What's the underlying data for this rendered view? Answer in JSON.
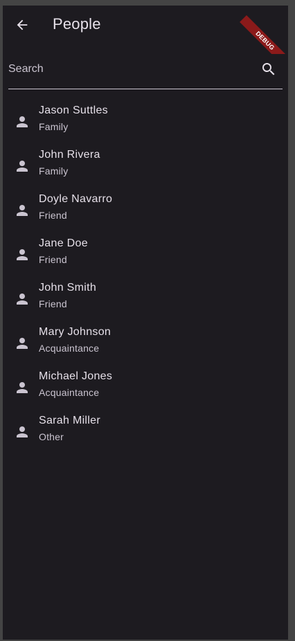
{
  "appbar": {
    "title": "People",
    "back_icon": "arrow-back-icon",
    "debug_label": "DEBUG"
  },
  "search": {
    "placeholder": "Search",
    "value": "",
    "icon": "search-icon"
  },
  "colors": {
    "background": "#1d1b20",
    "text_primary": "#e6e0e9",
    "text_secondary": "#cac4d0",
    "debug_banner": "#8b1a1a"
  },
  "contacts": [
    {
      "name": "Jason Suttles",
      "group": "Family",
      "icon": "person-icon"
    },
    {
      "name": "John Rivera",
      "group": "Family",
      "icon": "person-icon"
    },
    {
      "name": "Doyle Navarro",
      "group": "Friend",
      "icon": "person-icon"
    },
    {
      "name": "Jane Doe",
      "group": "Friend",
      "icon": "person-icon"
    },
    {
      "name": "John Smith",
      "group": "Friend",
      "icon": "person-icon"
    },
    {
      "name": "Mary Johnson",
      "group": "Acquaintance",
      "icon": "person-icon"
    },
    {
      "name": "Michael Jones",
      "group": "Acquaintance",
      "icon": "person-icon"
    },
    {
      "name": "Sarah Miller",
      "group": "Other",
      "icon": "person-icon"
    }
  ]
}
